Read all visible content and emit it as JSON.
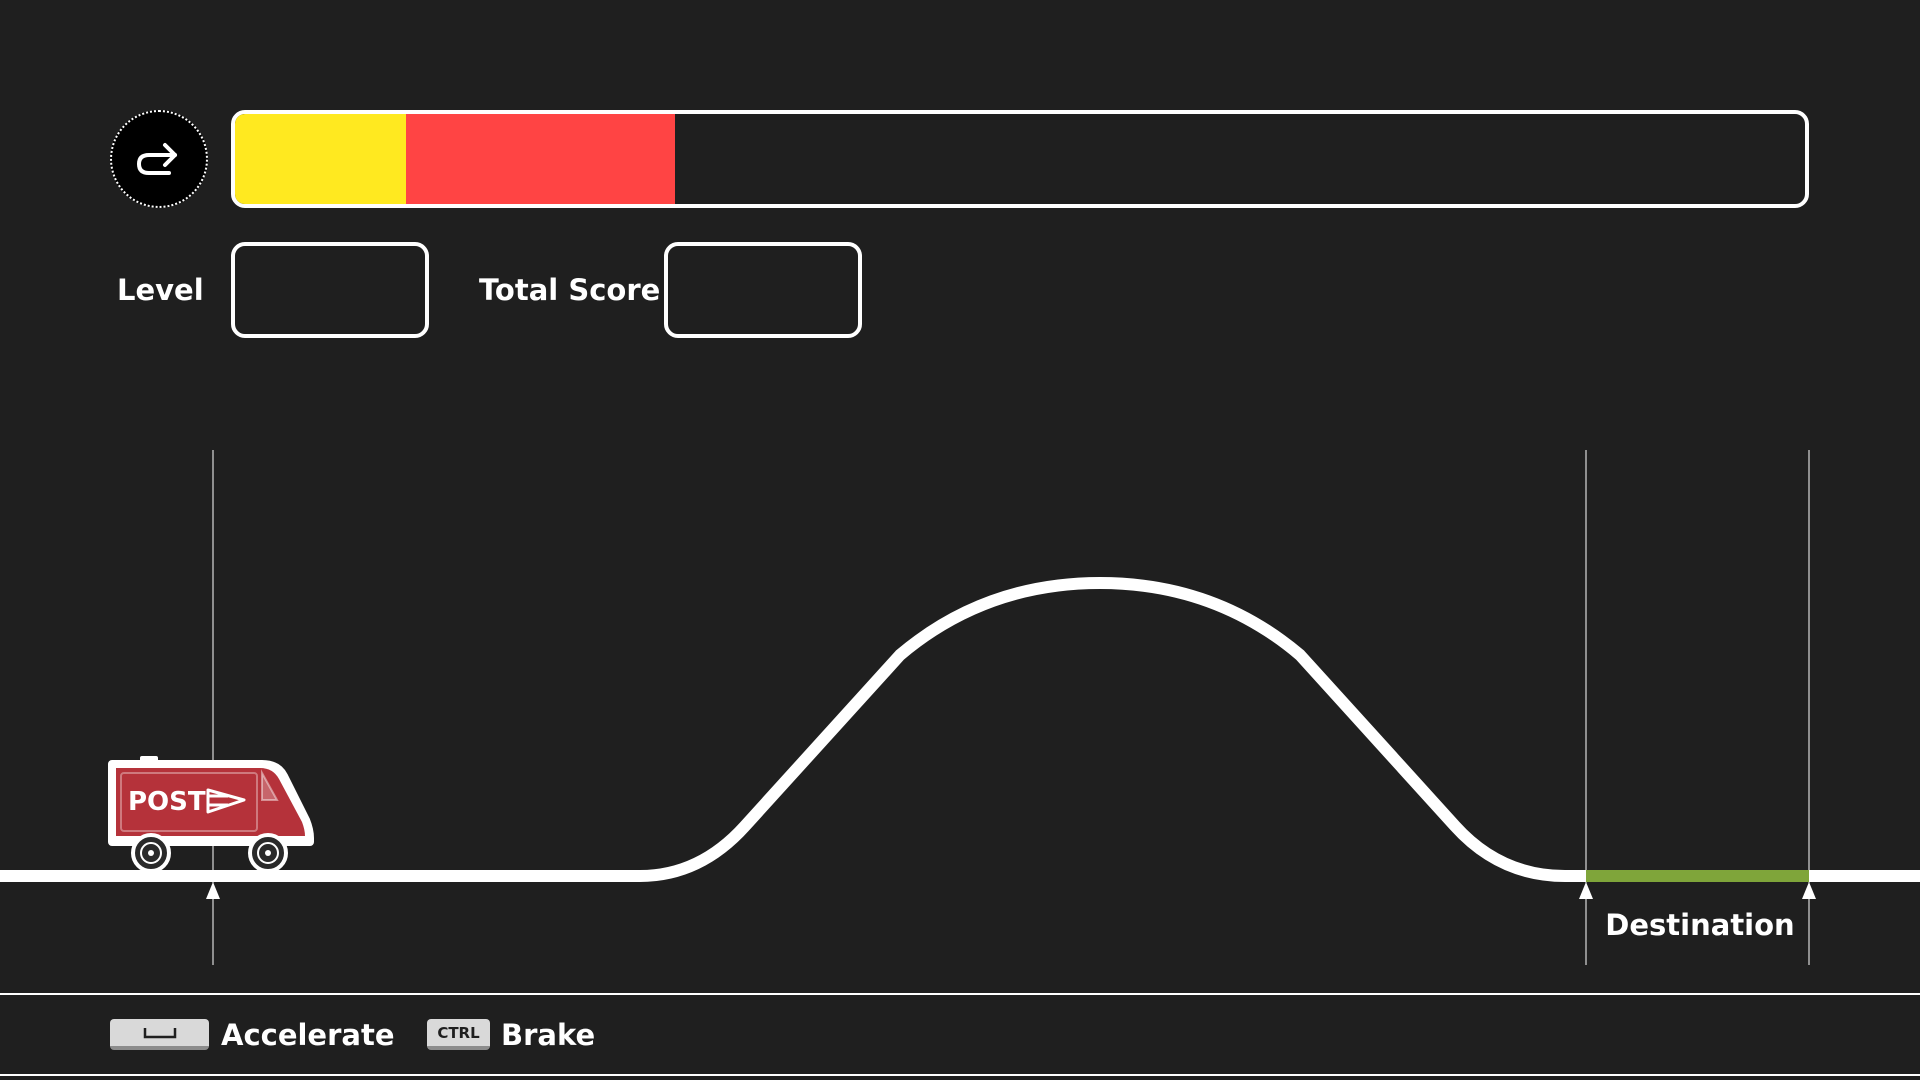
{
  "hud": {
    "restart_icon": "redo-arrow-icon",
    "progress": {
      "segments": [
        {
          "name": "yellow",
          "color": "#ffe920",
          "fraction": 0.109
        },
        {
          "name": "red",
          "color": "#ff4444",
          "fraction": 0.171
        }
      ],
      "empty_color": "#1f1f1f"
    },
    "level_label": "Level",
    "level_value": "",
    "score_label": "Total Score",
    "score_value": ""
  },
  "track": {
    "line_color": "#ffffff",
    "destination_color": "#7fa53a",
    "destination_label": "Destination"
  },
  "vehicle": {
    "label": "POST",
    "body_color": "#b5323a",
    "icon": "post-van-icon"
  },
  "controls": {
    "accelerate": {
      "key_label": "",
      "key_icon": "spacebar-icon",
      "label": "Accelerate"
    },
    "brake": {
      "key_label": "CTRL",
      "label": "Brake"
    }
  }
}
